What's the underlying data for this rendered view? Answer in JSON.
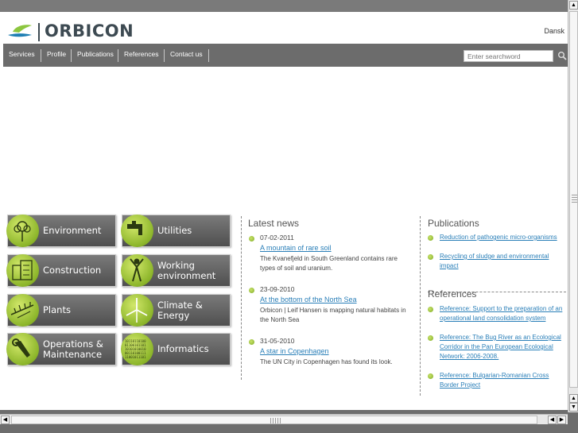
{
  "header": {
    "logo_text": "ORBICON",
    "language": "Dansk"
  },
  "nav": {
    "items": [
      "Services",
      "Profile",
      "Publications",
      "References",
      "Contact us"
    ],
    "search_placeholder": "Enter searchword"
  },
  "categories": [
    {
      "label": "Environment",
      "icon": "flower-icon"
    },
    {
      "label": "Utilities",
      "icon": "faucet-icon"
    },
    {
      "label": "Construction",
      "icon": "building-icon"
    },
    {
      "label": "Working\nenvironment",
      "icon": "person-icon"
    },
    {
      "label": "Plants",
      "icon": "plant-icon"
    },
    {
      "label": "Climate &\nEnergy",
      "icon": "wind-turbine-icon"
    },
    {
      "label": "Operations &\nMaintenance",
      "icon": "wrench-icon"
    },
    {
      "label": "Informatics",
      "icon": "binary-icon"
    }
  ],
  "latest_news": {
    "title": "Latest news",
    "items": [
      {
        "date": "07-02-2011",
        "link": "A mountain of rare soil",
        "description": "The Kvanefjeld in South Greenland contains rare types of soil and uranium."
      },
      {
        "date": "23-09-2010",
        "link": "At the bottom of the North Sea",
        "description": "Orbicon | Leif Hansen is mapping natural habitats in the North Sea"
      },
      {
        "date": "31-05-2010",
        "link": "A star in Copenhagen",
        "description": "The UN City in Copenhagen has found its look."
      }
    ]
  },
  "publications": {
    "title": "Publications",
    "items": [
      "Reduction of pathogenic micro-organisms",
      "Recycling of sludge and environmental impact"
    ]
  },
  "references": {
    "title": "References",
    "items": [
      "Reference: Support to the preparation of an operational land consolidation system",
      "Reference: The Bug River as an Ecological Corridor in the Pan European Ecological Network: 2006-2008.",
      "Reference: Bulgarian-Romanian Cross Border Project"
    ]
  },
  "colors": {
    "accent_green": "#8cb52a",
    "link_blue": "#2a7fb8",
    "nav_gray": "#6c6c6c"
  }
}
